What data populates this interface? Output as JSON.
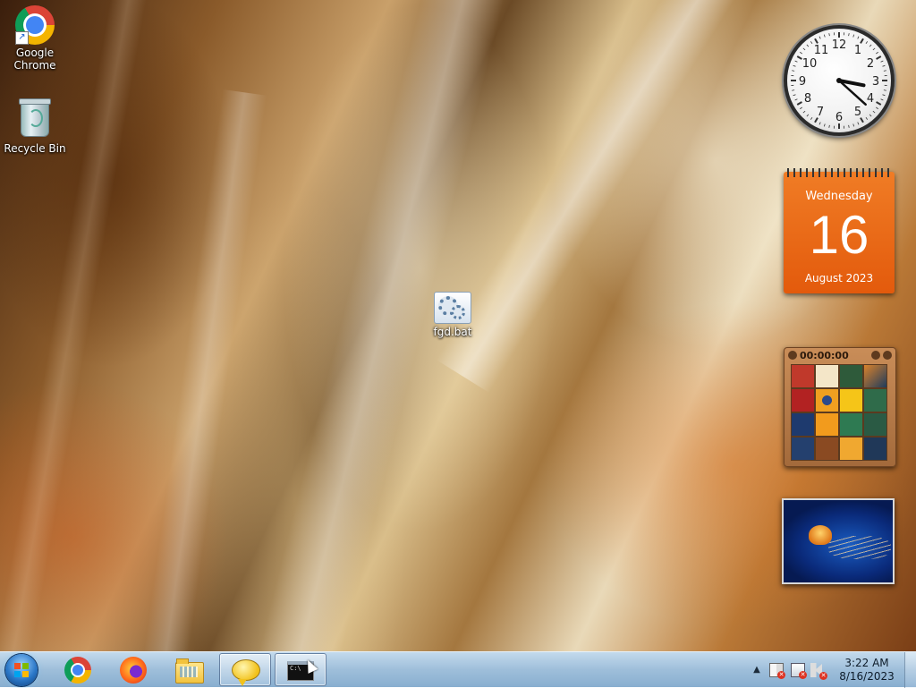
{
  "desktop": {
    "icons": [
      {
        "label": "Google Chrome",
        "icon": "chrome-icon"
      },
      {
        "label": "Recycle Bin",
        "icon": "recycle-bin-icon"
      },
      {
        "label": "fgd.bat",
        "icon": "batch-file-icon"
      }
    ]
  },
  "gadgets": {
    "clock": {
      "numbers": [
        "12",
        "1",
        "2",
        "3",
        "4",
        "5",
        "6",
        "7",
        "8",
        "9",
        "10",
        "11"
      ],
      "time": "3:22"
    },
    "calendar": {
      "weekday": "Wednesday",
      "date": "16",
      "month_year": "August 2023",
      "color": "#e8661a"
    },
    "puzzle": {
      "timer": "00:00:00"
    },
    "slideshow": {
      "subject": "jellyfish-image"
    }
  },
  "taskbar": {
    "start": "start-button",
    "pinned": [
      {
        "name": "taskbar-chrome",
        "icon": "chrome-icon"
      },
      {
        "name": "taskbar-firefox",
        "icon": "firefox-icon"
      },
      {
        "name": "taskbar-explorer",
        "icon": "folder-icon"
      },
      {
        "name": "taskbar-chat",
        "icon": "speech-bubble-icon"
      },
      {
        "name": "taskbar-cmd",
        "icon": "command-prompt-icon",
        "active": true,
        "text": "C:\\"
      }
    ],
    "tray": {
      "chevron": "▲",
      "time": "3:22 AM",
      "date": "8/16/2023"
    }
  }
}
